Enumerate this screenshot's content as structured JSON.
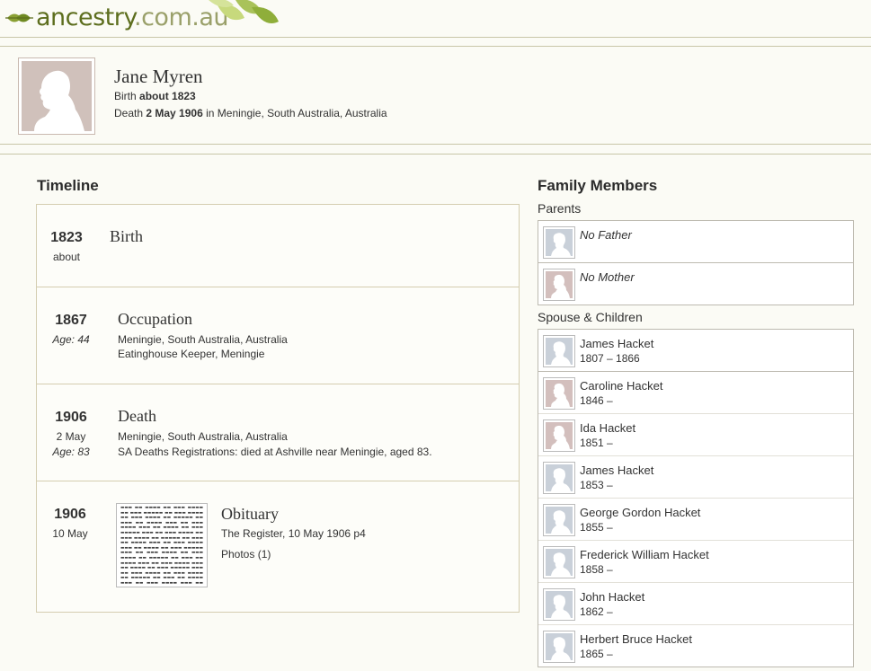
{
  "brand": {
    "name": "ancestry",
    "domain": ".com.au",
    "tm": "™"
  },
  "colors": {
    "accent": "#5d6e1e",
    "male": "#c9d0d9",
    "female": "#d3bfbd"
  },
  "person": {
    "name": "Jane Myren",
    "birth_label": "Birth",
    "birth_value": "about 1823",
    "death_label": "Death",
    "death_value": "2 May 1906",
    "death_place": "in Meningie, South Australia, Australia"
  },
  "timeline": {
    "title": "Timeline",
    "events": [
      {
        "year": "1823",
        "sub": "about",
        "age": "",
        "title": "Birth",
        "lines": []
      },
      {
        "year": "1867",
        "sub": "",
        "age": "Age: 44",
        "title": "Occupation",
        "lines": [
          "Meningie, South Australia, Australia",
          "Eatinghouse Keeper, Meningie"
        ]
      },
      {
        "year": "1906",
        "sub": "2 May",
        "age": "Age: 83",
        "title": "Death",
        "lines": [
          "Meningie, South Australia, Australia",
          "SA Deaths Registrations: died at Ashville near Meningie, aged 83."
        ]
      },
      {
        "year": "1906",
        "sub": "10 May",
        "age": "",
        "title": "Obituary",
        "lines": [
          "The Register, 10 May 1906 p4",
          "Photos (1)"
        ]
      }
    ]
  },
  "family": {
    "title": "Family Members",
    "parents_label": "Parents",
    "parents": [
      {
        "name": "No Father",
        "gender": "m"
      },
      {
        "name": "No Mother",
        "gender": "f"
      }
    ],
    "spouse_label": "Spouse & Children",
    "members": [
      {
        "name": "James Hacket",
        "dates": "1807 – 1866",
        "gender": "m"
      },
      {
        "name": "Caroline Hacket",
        "dates": "1846 –",
        "gender": "f"
      },
      {
        "name": "Ida Hacket",
        "dates": "1851 –",
        "gender": "f"
      },
      {
        "name": "James Hacket",
        "dates": "1853 –",
        "gender": "m"
      },
      {
        "name": "George Gordon Hacket",
        "dates": "1855 –",
        "gender": "m"
      },
      {
        "name": "Frederick William Hacket",
        "dates": "1858 –",
        "gender": "m"
      },
      {
        "name": "John Hacket",
        "dates": "1862 –",
        "gender": "m"
      },
      {
        "name": "Herbert Bruce Hacket",
        "dates": "1865 –",
        "gender": "m"
      }
    ]
  }
}
